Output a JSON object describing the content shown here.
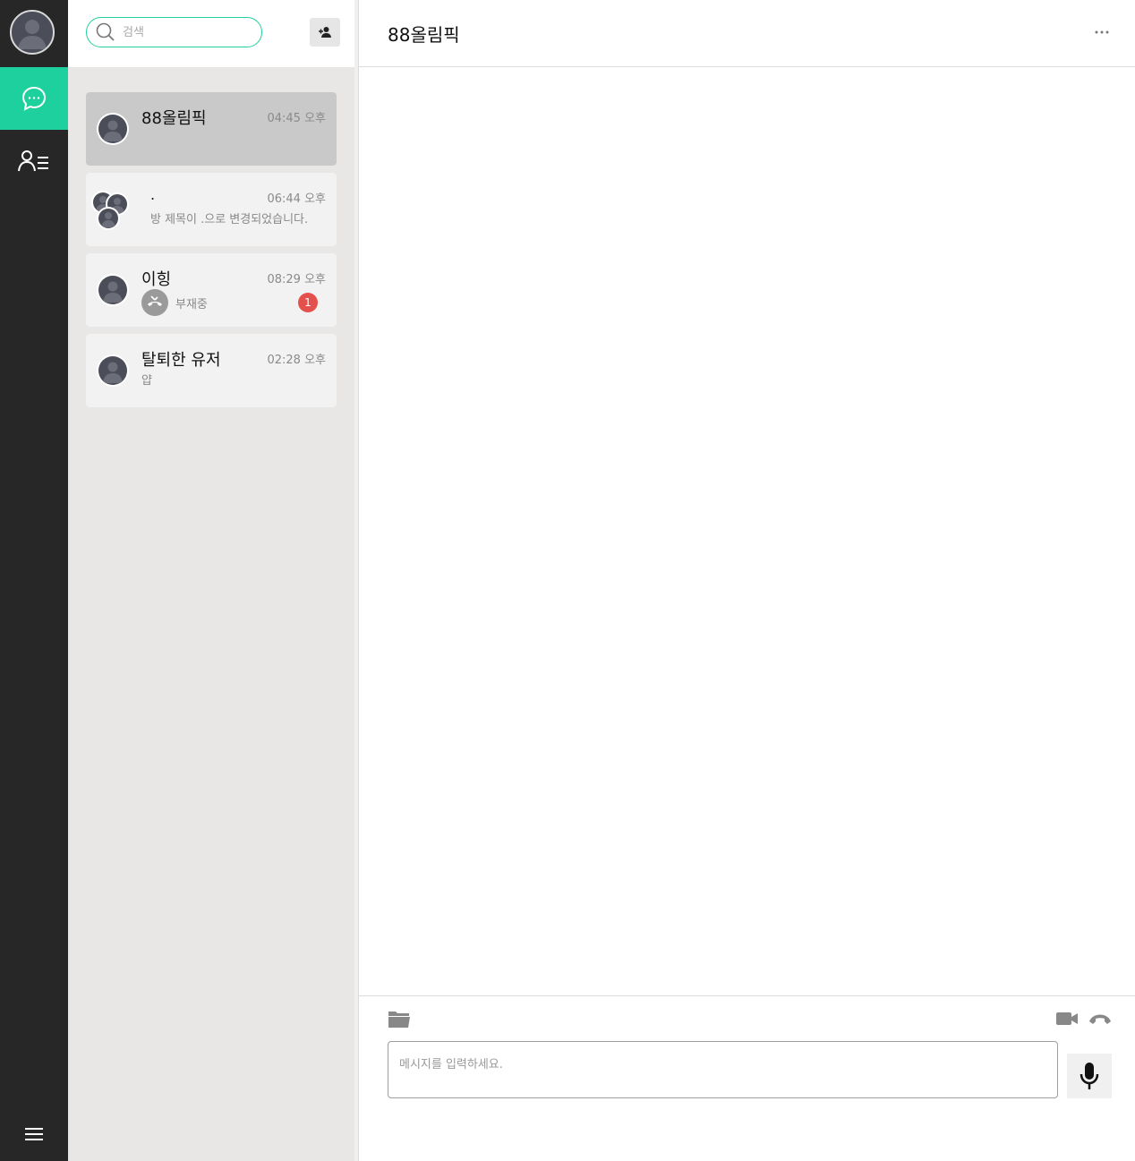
{
  "sidebar": {
    "profile_icon": "user-avatar",
    "items": [
      {
        "name": "chat",
        "icon": "chat-bubble-icon",
        "active": true
      },
      {
        "name": "friends",
        "icon": "user-list-icon",
        "active": false
      }
    ],
    "menu_icon": "hamburger-icon"
  },
  "search": {
    "placeholder": "검색"
  },
  "rooms": [
    {
      "name": "88올림픽",
      "time": "04:45 오후",
      "preview": "",
      "active": true
    },
    {
      "name": ".",
      "time": "06:44 오후",
      "preview": "방 제목이 .으로 변경되었습니다.",
      "active": false,
      "group": true
    },
    {
      "name": "이힝",
      "time": "08:29 오후",
      "status": "부재중",
      "unread": "1",
      "active": false
    },
    {
      "name": "탈퇴한 유저",
      "time": "02:28 오후",
      "preview": "얍",
      "active": false
    }
  ],
  "chat": {
    "title": "88올림픽",
    "input_placeholder": "메시지를 입력하세요."
  },
  "colors": {
    "accent": "#1ed09d",
    "rail": "#272727",
    "list_bg": "#e8e7e6",
    "badge": "#e4514d"
  }
}
